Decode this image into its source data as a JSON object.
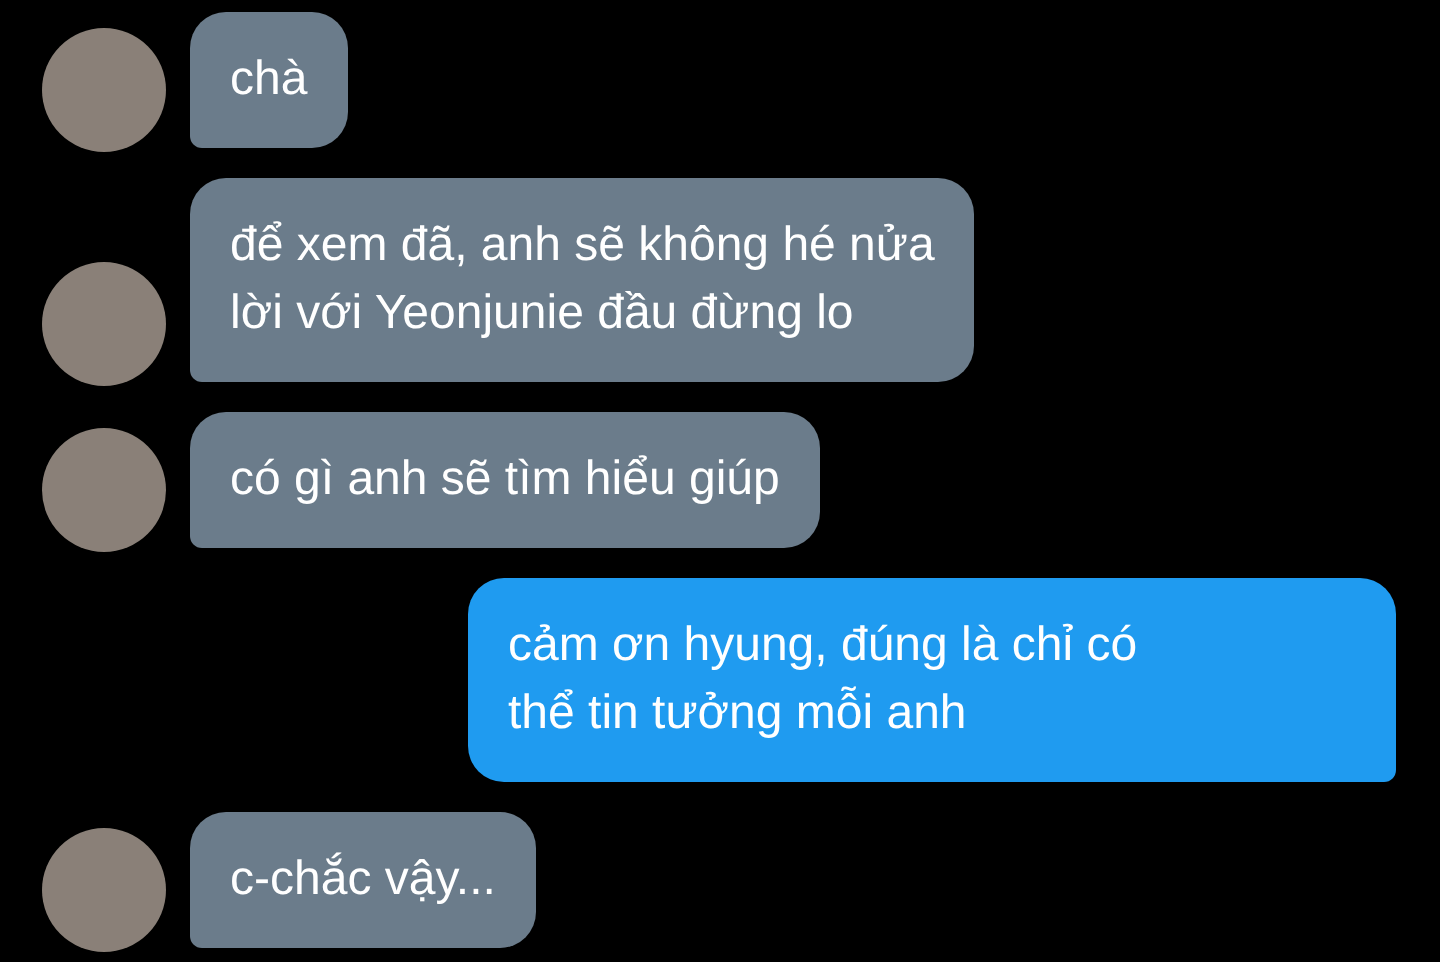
{
  "messages": [
    {
      "kind": "received",
      "text": "chà"
    },
    {
      "kind": "received",
      "text": "để xem đã, anh sẽ không hé nửa\nlời với Yeonjunie đầu đừng lo"
    },
    {
      "kind": "received",
      "text": "có gì anh sẽ tìm hiểu giúp"
    },
    {
      "kind": "sent",
      "text": "cảm ơn hyung, đúng là chỉ có\nthể tin tưởng mỗi anh"
    },
    {
      "kind": "received",
      "text": "c-chắc vậy..."
    }
  ]
}
